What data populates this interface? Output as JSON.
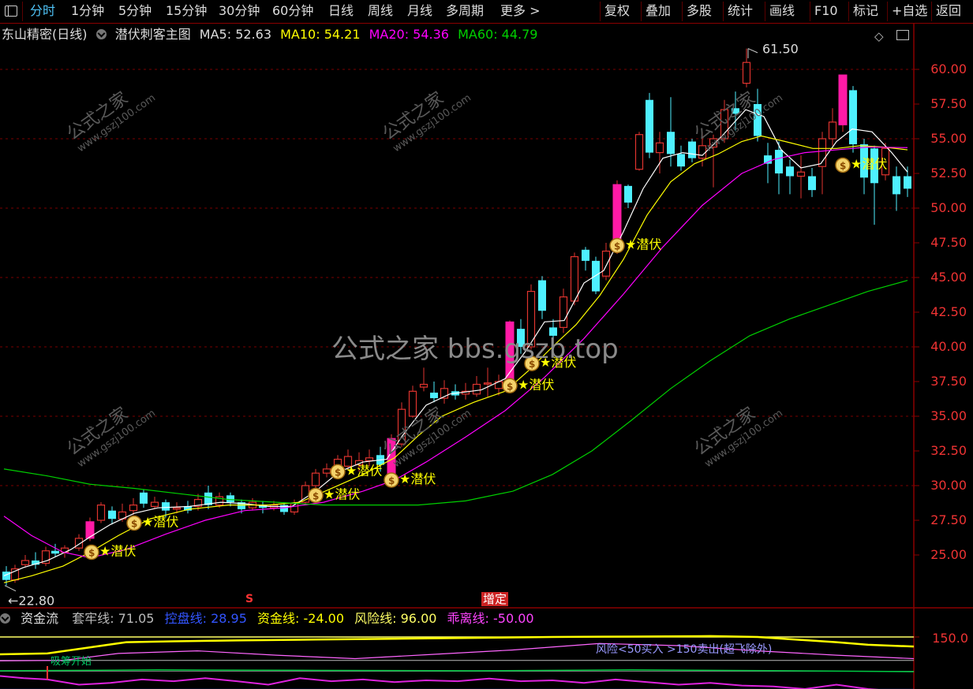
{
  "toolbar": {
    "left_items": [
      "分时",
      "1分钟",
      "5分钟",
      "15分钟",
      "30分钟",
      "60分钟",
      "日线",
      "周线",
      "月线",
      "多周期",
      "更多 >"
    ],
    "right_items": [
      "复权",
      "叠加",
      "多股",
      "统计",
      "画线",
      "F10",
      "标记",
      "+自选",
      "返回"
    ]
  },
  "main_panel": {
    "stock_name": "东山精密(日线)",
    "indicator_name": "潜伏刺客主图",
    "ma5": "MA5: 52.63",
    "ma10": "MA10: 54.21",
    "ma20": "MA20: 54.36",
    "ma60": "MA60: 44.79",
    "high_marker": "61.50",
    "low_marker": "22.80",
    "y_ticks": [
      "60.00",
      "57.50",
      "55.00",
      "52.50",
      "50.00",
      "47.50",
      "45.00",
      "42.50",
      "40.00",
      "37.50",
      "35.00",
      "32.50",
      "30.00",
      "27.50",
      "25.00"
    ],
    "signal_label": "潜伏",
    "event_label": "增定",
    "event_s": "S",
    "watermark_center": "公式之家 bbs.gszb.top",
    "watermark_small_cn": "公式之家",
    "watermark_small_url": "www.gszj100.com"
  },
  "sub_panel": {
    "name": "资金流",
    "tao_lao": "套牢线: 71.05",
    "kong_pan": "控盘线: 28.95",
    "zi_jin": "资金线: -24.00",
    "feng_xian": "风险线: 96.00",
    "guai_li": "乖离线: -50.00",
    "y_tick": "150.0",
    "note_risk": "风险<50买入 >150卖出(超飞除外)",
    "note_left": "吸筹开始"
  },
  "colors": {
    "up": "#e0342f",
    "up_fill": "#ff1aa6",
    "down": "#4ef0ff",
    "ma5": "#ffffff",
    "ma10": "#ffff00",
    "ma20": "#ff00ff",
    "ma60": "#00d000",
    "grid": "#7a0000",
    "axis_label": "#e33"
  }
}
